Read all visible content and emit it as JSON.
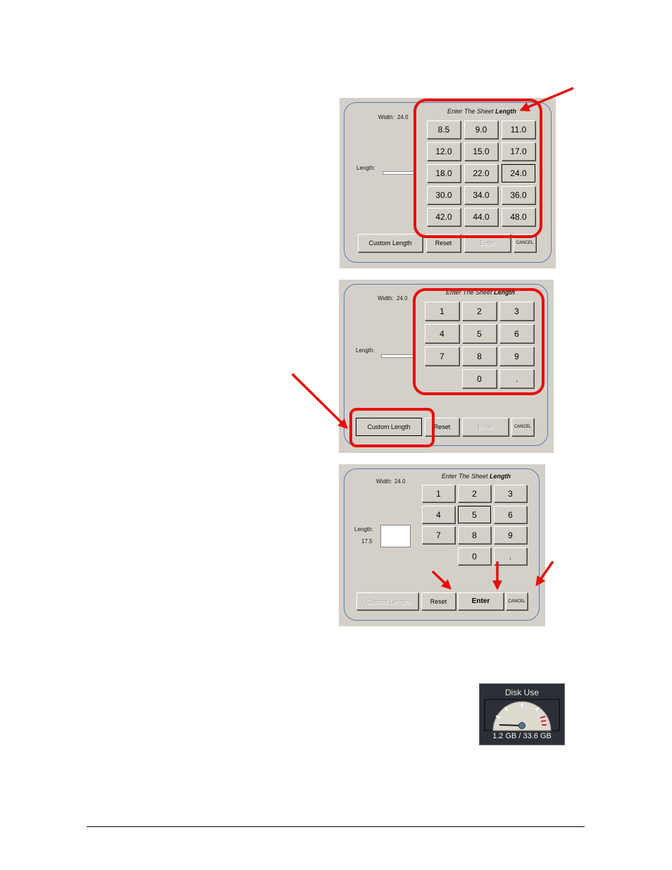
{
  "panels": [
    {
      "width_label": "Width:",
      "width_value": "24.0",
      "length_label": "Length:",
      "title_prefix": "Enter The Sheet",
      "title_emphasis": "Length",
      "keys": [
        "8.5",
        "9.0",
        "11.0",
        "12.0",
        "15.0",
        "17.0",
        "18.0",
        "22.0",
        "24.0",
        "30.0",
        "34.0",
        "36.0",
        "42.0",
        "44.0",
        "48.0"
      ],
      "selected_key": "24.0",
      "custom_length": "Custom Length",
      "reset": "Reset",
      "enter": "Enter",
      "cancel": "CANCEL"
    },
    {
      "width_label": "Width:",
      "width_value": "24.0",
      "length_label": "Length:",
      "title_prefix": "Enter The Sheet",
      "title_emphasis": "Length",
      "keys": [
        "1",
        "2",
        "3",
        "4",
        "5",
        "6",
        "7",
        "8",
        "9",
        "0",
        "."
      ],
      "custom_length": "Custom Length",
      "reset": "Reset",
      "enter": "Enter",
      "cancel": "CANCEL"
    },
    {
      "width_label": "Width:",
      "width_value": "24.0",
      "length_label": "Length:",
      "length_value": "17.5",
      "title_prefix": "Enter The Sheet",
      "title_emphasis": "Length",
      "keys": [
        "1",
        "2",
        "3",
        "4",
        "5",
        "6",
        "7",
        "8",
        "9",
        "0",
        "."
      ],
      "selected_key": "5",
      "custom_length": "Custom Length",
      "reset": "Reset",
      "enter": "Enter",
      "cancel": "CANCEL"
    }
  ],
  "disk_use": {
    "title": "Disk Use",
    "used": "1.2 GB",
    "total": "33.6 GB",
    "value_text": "1.2 GB / 33.6 GB",
    "fraction_used": 0.036
  },
  "colors": {
    "dialog_bg": "#d4d0c8",
    "frame": "#5a78b8",
    "highlight": "#e50d0d",
    "gauge_bg": "#2c2f36"
  }
}
